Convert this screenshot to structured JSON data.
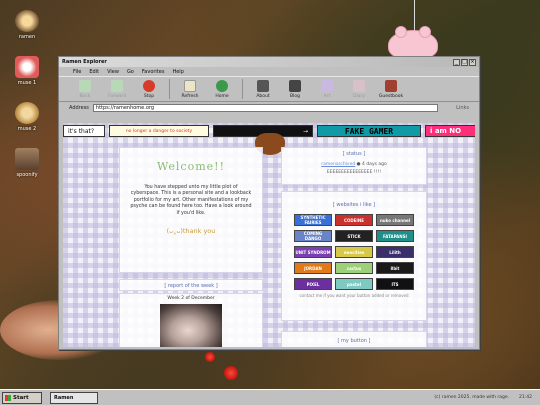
{
  "desktop": {
    "icons": [
      {
        "label": "ramen",
        "icon": "ramen-bowl-icon"
      },
      {
        "label": "muse 1",
        "icon": "cake-icon"
      },
      {
        "label": "muse 2",
        "icon": "bread-icon"
      },
      {
        "label": "spoonify",
        "icon": "figure-icon"
      }
    ]
  },
  "window": {
    "title": "Ramen Explorer",
    "menu": [
      "File",
      "Edit",
      "View",
      "Go",
      "Favorites",
      "Help"
    ],
    "toolbar": [
      {
        "label": "Back",
        "icon": "back-arrow-icon",
        "enabled": false
      },
      {
        "label": "Forward",
        "icon": "forward-arrow-icon",
        "enabled": false
      },
      {
        "label": "Stop",
        "icon": "stop-icon",
        "enabled": true
      },
      {
        "label": "Refresh",
        "icon": "refresh-icon",
        "enabled": true
      },
      {
        "label": "Home",
        "icon": "home-icon",
        "enabled": true
      },
      {
        "label": "About",
        "icon": "about-icon",
        "enabled": true
      },
      {
        "label": "Blog",
        "icon": "blog-icon",
        "enabled": true
      },
      {
        "label": "Art",
        "icon": "art-icon",
        "enabled": false
      },
      {
        "label": "Diary",
        "icon": "diary-icon",
        "enabled": false
      },
      {
        "label": "Guestbook",
        "icon": "guestbook-icon",
        "enabled": true
      }
    ],
    "address_label": "Address",
    "address_value": "https://ramenhome.org",
    "links_label": "Links"
  },
  "page": {
    "marquee": {
      "whats_that": "it's that?",
      "danger": "no longer a danger to society",
      "fake_gamer": "FAKE GAMER",
      "iam": "i am NO"
    },
    "welcome": {
      "heading": "Welcome!!",
      "body": "You have stepped unto my little plot of cyberspace. This is a personal site and a lookback portfolio for my art. Other manifestations of my psyche can be found here too. Have a look around if you'd like.",
      "thanks": "(ᴗ˳ᴗ)thank you"
    },
    "report": {
      "heading": "[ report of the week ]",
      "week": "Week 2 of December"
    },
    "status": {
      "heading": "[ status ]",
      "user": "ramenarchived",
      "when": "4 days ago",
      "message": "EEEEEEEEEEEEEEEE !!!!"
    },
    "websites": {
      "heading": "[ websites i like ]",
      "buttons": [
        {
          "label": "SYNTHETIC FAIRIES",
          "color": "#3a6fd8"
        },
        {
          "label": "CODEINE",
          "color": "#c8312e"
        },
        {
          "label": "nuko channel",
          "color": "#777777"
        },
        {
          "label": "COMING DANGO",
          "color": "#6a84c8"
        },
        {
          "label": "STICK",
          "color": "#222222"
        },
        {
          "label": "FATAPANSI",
          "color": "#1f8f8a"
        },
        {
          "label": "UNIT SYNDROM",
          "color": "#7a3fb0"
        },
        {
          "label": "neocities",
          "color": "#d8c84a"
        },
        {
          "label": "Lilith",
          "color": "#3a2f6a"
        },
        {
          "label": "JORDAN",
          "color": "#e07a1a"
        },
        {
          "label": "cactus",
          "color": "#9ed07a"
        },
        {
          "label": "8bit",
          "color": "#1a1a1a"
        },
        {
          "label": "PIXEL",
          "color": "#6b2fa0"
        },
        {
          "label": "pastel",
          "color": "#7ec9c1"
        },
        {
          "label": "ITS",
          "color": "#111111"
        }
      ],
      "note": "contact me if you want your button added or removed"
    },
    "my_button": "[ my button ]"
  },
  "taskbar": {
    "start": "Start",
    "task": "Ramen Explorer",
    "credit": "(c) ramen 2025. made with rage.",
    "clock": "21:42"
  }
}
